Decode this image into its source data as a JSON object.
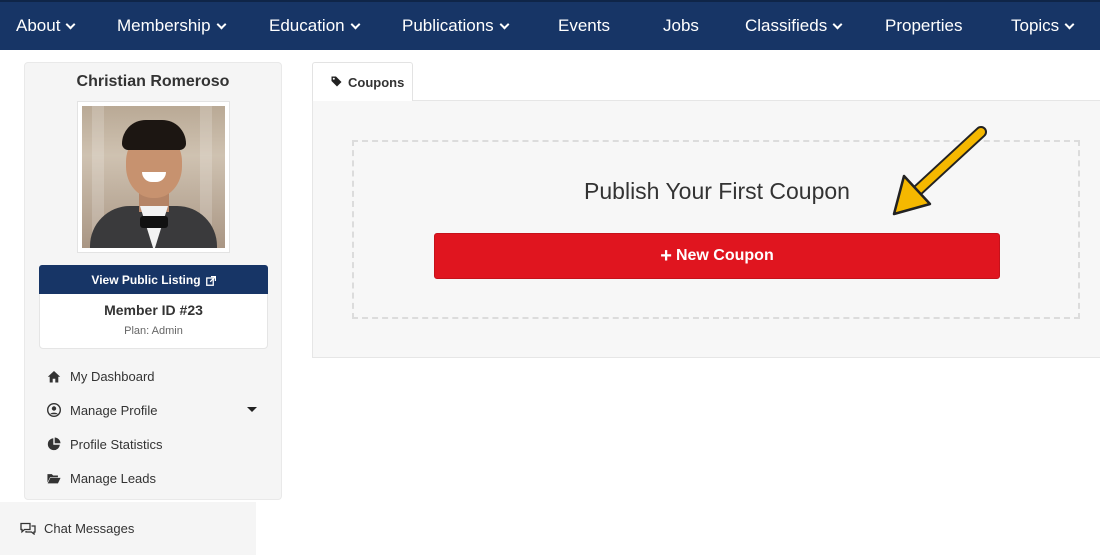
{
  "nav": {
    "items": [
      {
        "label": "About",
        "dropdown": true
      },
      {
        "label": "Membership",
        "dropdown": true
      },
      {
        "label": "Education",
        "dropdown": true
      },
      {
        "label": "Publications",
        "dropdown": true
      },
      {
        "label": "Events",
        "dropdown": false
      },
      {
        "label": "Jobs",
        "dropdown": false
      },
      {
        "label": "Classifieds",
        "dropdown": true
      },
      {
        "label": "Properties",
        "dropdown": false
      },
      {
        "label": "Topics",
        "dropdown": true
      }
    ]
  },
  "sidebar": {
    "member_name": "Christian Romeroso",
    "view_listing_label": "View Public Listing",
    "member_id": "Member ID #23",
    "plan": "Plan: Admin",
    "menu": [
      {
        "label": "My Dashboard",
        "icon": "home-icon"
      },
      {
        "label": "Manage Profile",
        "icon": "user-circle-icon",
        "expandable": true
      },
      {
        "label": "Profile Statistics",
        "icon": "pie-chart-icon"
      },
      {
        "label": "Manage Leads",
        "icon": "folder-open-icon"
      }
    ],
    "chat_label": "Chat Messages"
  },
  "main": {
    "tab_label": "Coupons",
    "heading": "Publish Your First Coupon",
    "button_label": "New Coupon"
  },
  "colors": {
    "nav_bg": "#173566",
    "button_red": "#e0151f",
    "arrow_yellow": "#f5b800"
  }
}
